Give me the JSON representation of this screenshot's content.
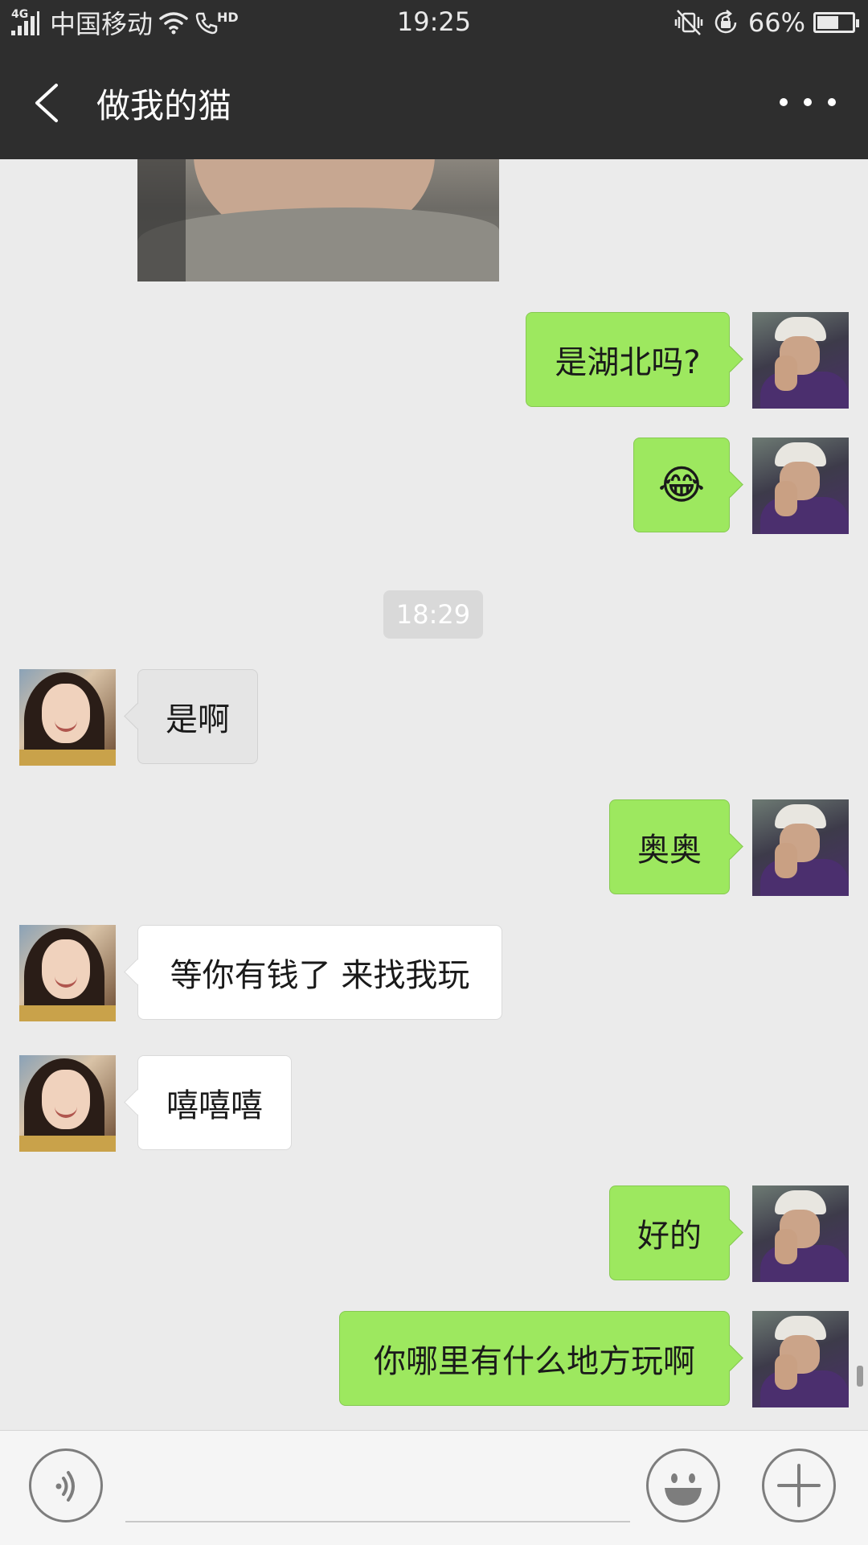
{
  "status_bar": {
    "network": "4G",
    "carrier": "中国移动",
    "hd_label": "HD",
    "time": "19:25",
    "battery": "66%",
    "battery_level": 0.66
  },
  "nav": {
    "back_icon": "chevron-left-icon",
    "title": "做我的猫",
    "more_icon": "more-dots-icon"
  },
  "messages": [
    {
      "side": "right",
      "text": "是湖北吗?"
    },
    {
      "side": "right",
      "text": "😂"
    },
    {
      "type": "timestamp",
      "text": "18:29"
    },
    {
      "side": "left",
      "text": "是啊"
    },
    {
      "side": "right",
      "text": "奥奥"
    },
    {
      "side": "left",
      "text": "等你有钱了 来找我玩"
    },
    {
      "side": "left",
      "text": "嘻嘻嘻"
    },
    {
      "side": "right",
      "text": "好的"
    },
    {
      "side": "right",
      "text": "你哪里有什么地方玩啊"
    }
  ],
  "input_bar": {
    "voice_icon": "voice-icon",
    "text_value": "",
    "emoji_icon": "emoji-icon",
    "plus_icon": "plus-icon"
  },
  "colors": {
    "header_bg": "#2e2e2e",
    "chat_bg": "#ebebeb",
    "self_bubble": "#9de85f",
    "other_bubble": "#ffffff"
  }
}
